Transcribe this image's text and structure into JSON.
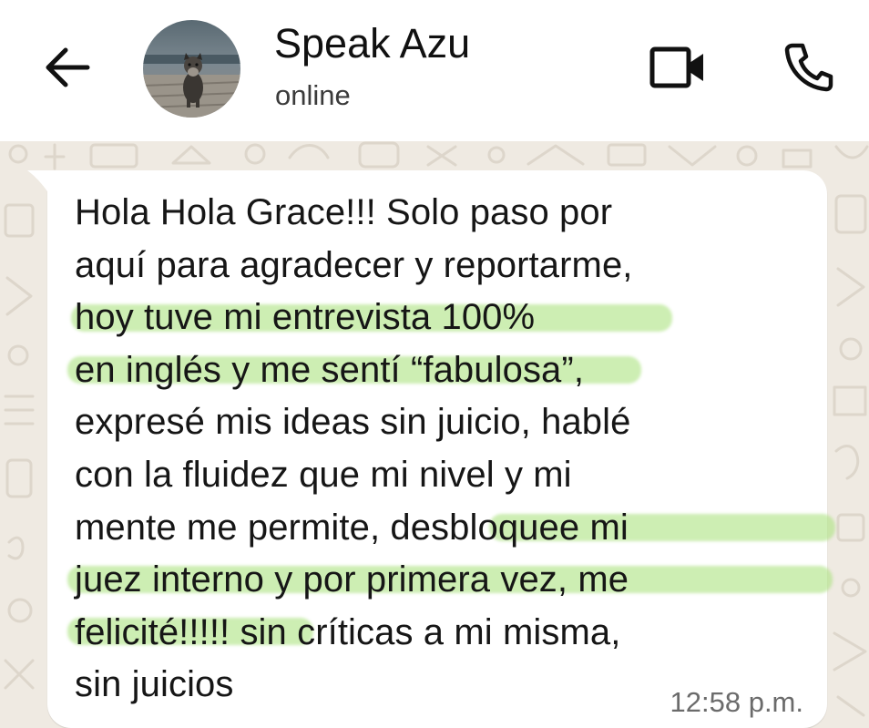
{
  "header": {
    "back_icon": "arrow-left-icon",
    "contact_name": "Speak Azu",
    "status": "online",
    "video_icon": "video-camera-icon",
    "call_icon": "phone-icon"
  },
  "message": {
    "text": "Hola Hola Grace!!! Solo paso por\naquí para agradecer y reportarme,\nhoy tuve mi entrevista 100%\nen inglés y me sentí “fabulosa”,\nexpresé mis ideas sin juicio, hablé\ncon la fluidez que mi nivel y mi\nmente me permite, desbloquee mi\njuez interno y por primera vez, me\nfelicité!!!!! sin críticas a mi misma,\nsin juicios",
    "time": "12:58 p.m.",
    "highlight_color": "#abe380"
  },
  "colors": {
    "header_bg": "#ffffff",
    "chat_bg": "#efeae2",
    "bubble_bg": "#ffffff",
    "text": "#161616",
    "timestamp": "#6b6b6b"
  }
}
